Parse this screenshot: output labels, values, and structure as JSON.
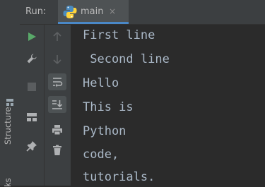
{
  "side_panel": {
    "structure_label": "Structure",
    "bookmarks_label": "ks"
  },
  "header": {
    "run_label": "Run:",
    "tab": {
      "title": "main",
      "close": "×"
    }
  },
  "toolbar": {
    "left": [
      "run-icon",
      "wrench-icon",
      "stop-icon",
      "layout-icon",
      "pin-icon"
    ],
    "right": [
      "up-arrow-icon",
      "down-arrow-icon",
      "soft-wrap-icon",
      "scroll-to-end-icon",
      "print-icon",
      "trash-icon"
    ]
  },
  "console": {
    "lines": [
      "First line",
      " Second line",
      "Hello",
      "This is",
      "Python",
      "code,",
      "tutorials."
    ]
  },
  "colors": {
    "background": "#2b2b2b",
    "panel": "#3c3f41",
    "text": "#a9b7c6",
    "run_green": "#59a869",
    "tab_underline": "#4a88c7"
  }
}
